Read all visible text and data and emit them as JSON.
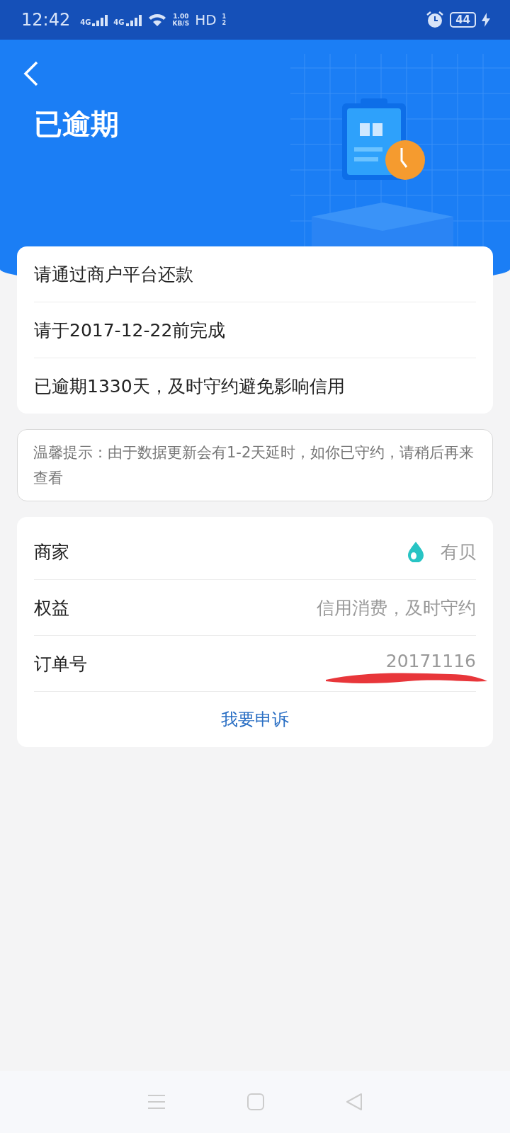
{
  "status_bar": {
    "time": "12:42",
    "networks": [
      "4G",
      "4G"
    ],
    "speed": "1.00",
    "speed_unit": "KB/S",
    "hd": "HD",
    "sim_slots": [
      "1",
      "2"
    ],
    "battery": "44"
  },
  "header": {
    "title": "已逾期"
  },
  "info_rows": [
    "请通过商户平台还款",
    "请于2017-12-22前完成",
    "已逾期1330天，及时守约避免影响信用"
  ],
  "notice": "温馨提示：由于数据更新会有1-2天延时，如你已守约，请稍后再来查看",
  "details": [
    {
      "kind": "merchant",
      "label": "商家",
      "value": "有贝"
    },
    {
      "kind": "text",
      "label": "权益",
      "value": "信用消费，及时守约"
    },
    {
      "kind": "redacted",
      "label": "订单号",
      "value": "20171116"
    }
  ],
  "appeal_link": "我要申诉"
}
